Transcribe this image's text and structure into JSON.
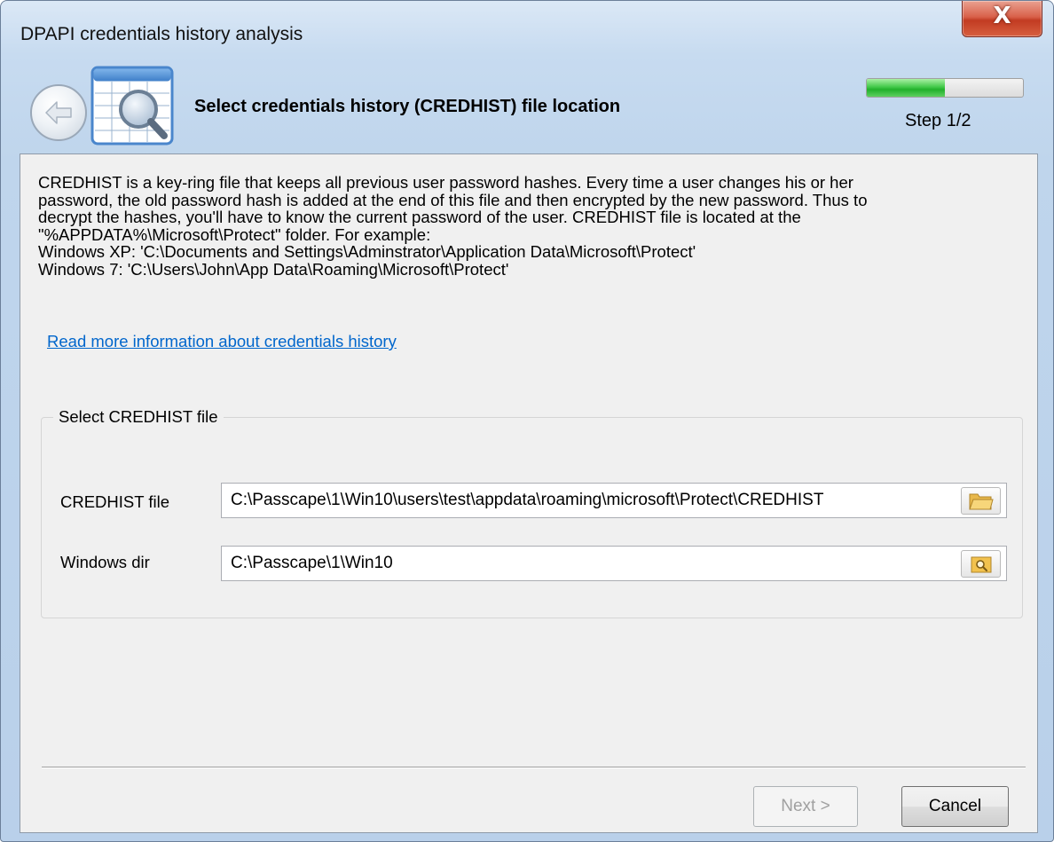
{
  "window": {
    "title": "DPAPI credentials history analysis",
    "close_label": "X"
  },
  "header": {
    "title": "Select credentials history (CREDHIST) file location",
    "step_label": "Step 1/2",
    "progress_fraction": 0.5,
    "icons": {
      "back": "back-arrow-icon",
      "wizard": "table-magnifier-icon"
    }
  },
  "description": {
    "lines": [
      "CREDHIST is a key-ring file that keeps all previous user password hashes. Every time a user changes his or her",
      "password, the old password hash is added at the end of this file and then encrypted by the new password. Thus to",
      "decrypt the hashes, you'll have to know the current password of the user. CREDHIST file is located at the",
      "\"%APPDATA%\\Microsoft\\Protect\" folder. For example:",
      "Windows XP:  'C:\\Documents and Settings\\Adminstrator\\Application Data\\Microsoft\\Protect'",
      "Windows 7:  'C:\\Users\\John\\App Data\\Roaming\\Microsoft\\Protect'"
    ],
    "link": "Read more information about credentials history"
  },
  "form": {
    "group_title": "Select CREDHIST file",
    "credhist_label": "CREDHIST file",
    "credhist_value": "C:\\Passcape\\1\\Win10\\users\\test\\appdata\\roaming\\microsoft\\Protect\\CREDHIST",
    "windir_label": "Windows dir",
    "windir_value": "C:\\Passcape\\1\\Win10",
    "credhist_browse_icon": "folder-open-icon",
    "windir_browse_icon": "folder-search-icon"
  },
  "buttons": {
    "next": "Next >",
    "cancel": "Cancel"
  },
  "colors": {
    "link": "#0066cc",
    "progress": "#22b02c",
    "close": "#c23b22"
  }
}
